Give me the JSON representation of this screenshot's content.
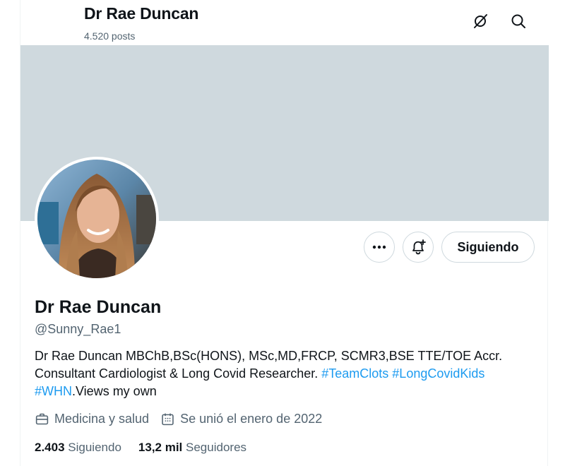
{
  "header": {
    "title": "Dr Rae Duncan",
    "posts_count": "4.520 posts"
  },
  "profile": {
    "name": "Dr Rae Duncan",
    "handle": "@Sunny_Rae1",
    "bio_text_1": "Dr Rae Duncan MBChB,BSc(HONS), MSc,MD,FRCP, SCMR3,BSE TTE/TOE Accr. Consultant Cardiologist & Long Covid Researcher. ",
    "bio_tag_1": "#TeamClots",
    "bio_tag_2": "#LongCovidKids",
    "bio_tag_3": "#WHN",
    "bio_text_2": ".Views my own",
    "category": "Medicina y salud",
    "joined": "Se unió el enero de 2022",
    "following_count": "2.403",
    "following_label": "Siguiendo",
    "followers_count": "13,2 mil",
    "followers_label": "Seguidores"
  },
  "actions": {
    "follow_label": "Siguiendo"
  },
  "icons": {
    "hide": "eye-slash-icon",
    "search": "search-icon",
    "more": "more-dots-icon",
    "notify": "bell-plus-icon",
    "category": "briefcase-icon",
    "joined": "calendar-icon"
  },
  "colors": {
    "banner": "#cfd9de",
    "link": "#1d9bf0",
    "secondary_text": "#536471"
  }
}
